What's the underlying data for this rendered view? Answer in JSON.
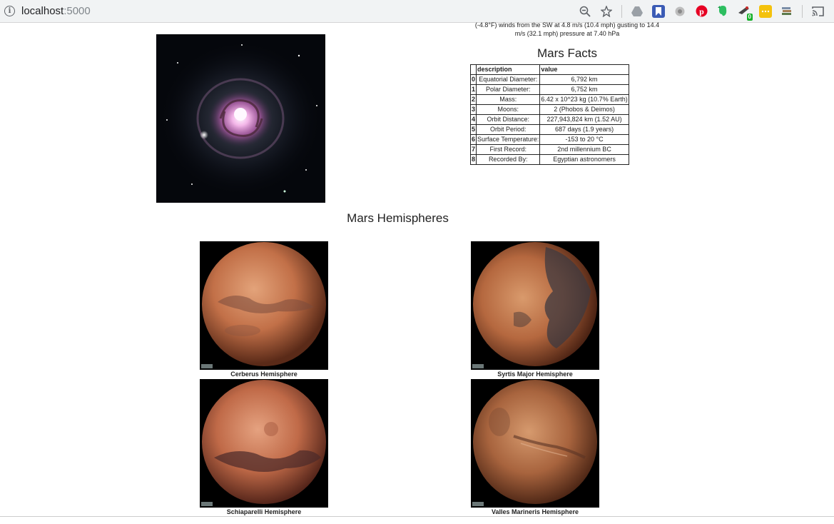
{
  "browser": {
    "host": "localhost",
    "port": ":5000",
    "icons": [
      "zoom-icon",
      "bookmark-star-icon",
      "drive-icon",
      "bookmarks-icon",
      "extension-icon",
      "pinterest-icon",
      "evernote-icon",
      "extension-badge-icon",
      "extension-icon",
      "extension-icon",
      "cast-icon"
    ],
    "badge_count": "0"
  },
  "weather": {
    "line1": "(-4.8°F) winds from the SW at 4.8 m/s (10.4 mph) gusting to 14.4",
    "line2": "m/s (32.1 mph) pressure at 7.40 hPa"
  },
  "facts": {
    "title": "Mars Facts",
    "headers": [
      "",
      "description",
      "value"
    ],
    "rows": [
      [
        "0",
        "Equatorial Diameter:",
        "6,792 km"
      ],
      [
        "1",
        "Polar Diameter:",
        "6,752 km"
      ],
      [
        "2",
        "Mass:",
        "6.42 x 10^23 kg (10.7% Earth)"
      ],
      [
        "3",
        "Moons:",
        "2 (Phobos & Deimos)"
      ],
      [
        "4",
        "Orbit Distance:",
        "227,943,824 km (1.52 AU)"
      ],
      [
        "5",
        "Orbit Period:",
        "687 days (1.9 years)"
      ],
      [
        "6",
        "Surface Temperature:",
        "-153 to 20 °C"
      ],
      [
        "7",
        "First Record:",
        "2nd millennium BC"
      ],
      [
        "8",
        "Recorded By:",
        "Egyptian astronomers"
      ]
    ]
  },
  "hemispheres": {
    "title": "Mars Hemispheres",
    "items": [
      {
        "caption": "Cerberus Hemisphere"
      },
      {
        "caption": "Syrtis Major Hemisphere"
      },
      {
        "caption": "Schiaparelli Hemisphere"
      },
      {
        "caption": "Valles Marineris Hemisphere"
      }
    ]
  }
}
